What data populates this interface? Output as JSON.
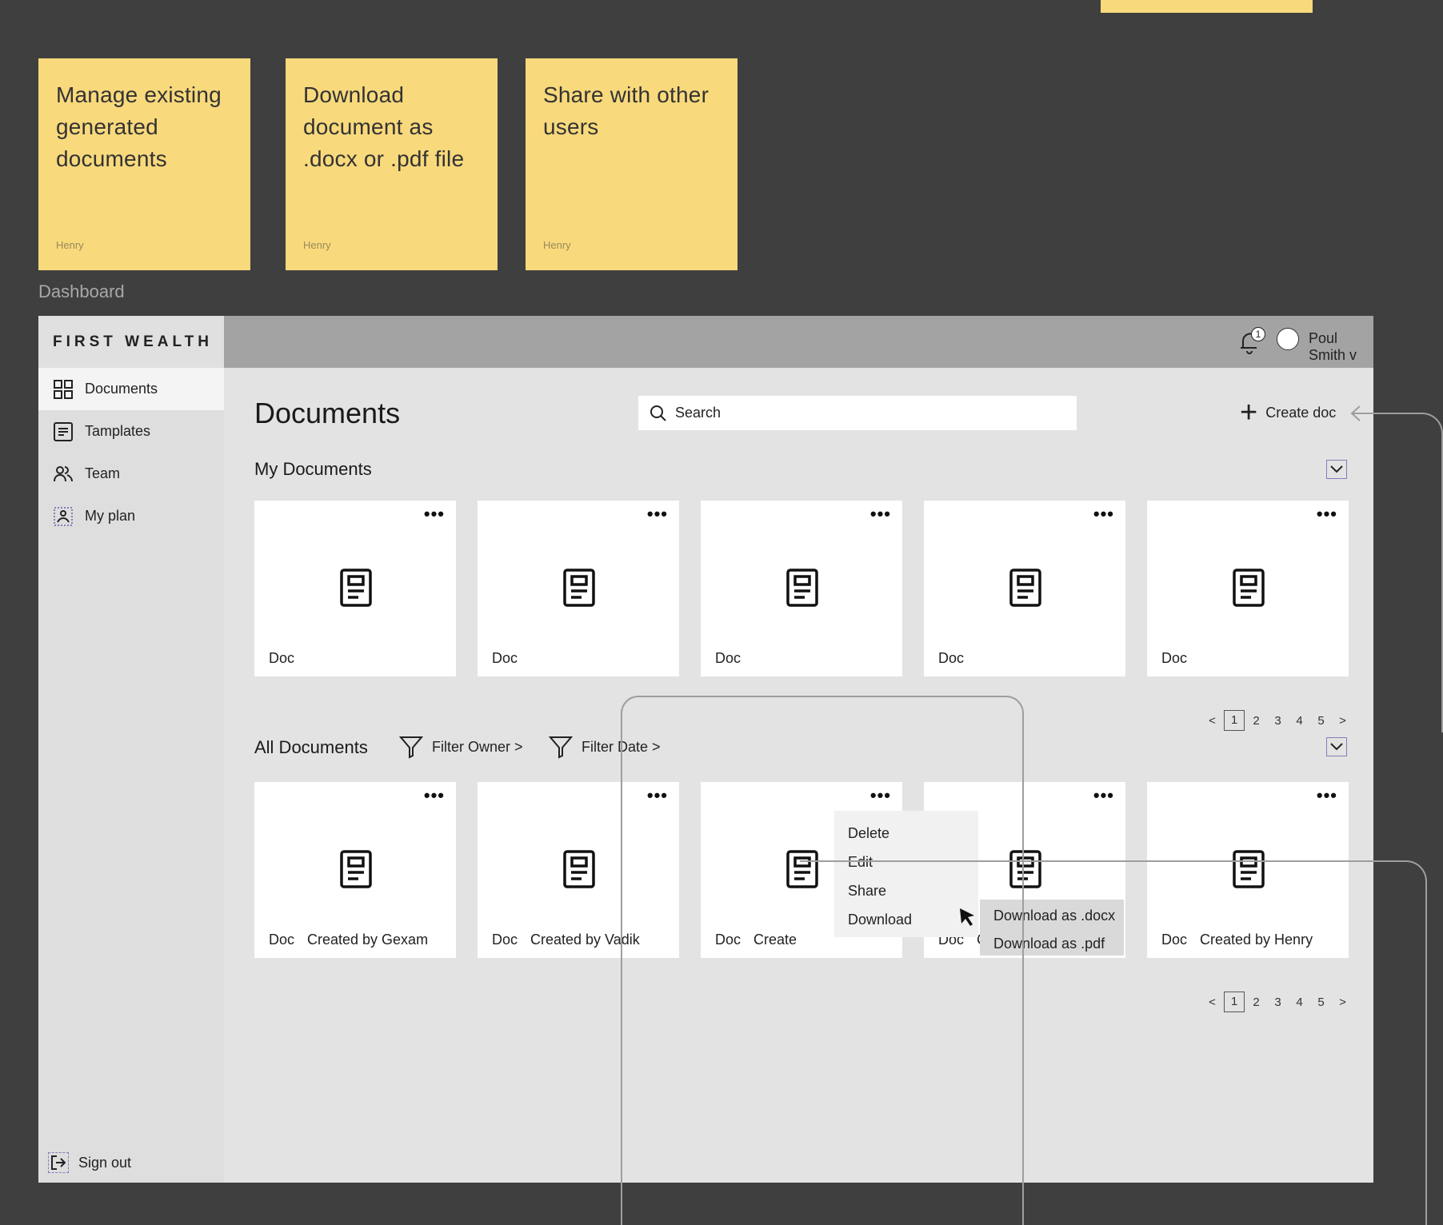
{
  "stickies": [
    {
      "text": "Manage existing generated documents",
      "author": "Henry"
    },
    {
      "text": "Download document as .docx or .pdf file",
      "author": "Henry"
    },
    {
      "text": "Share with other users",
      "author": "Henry"
    }
  ],
  "frame_label": "Dashboard",
  "app": {
    "logo": "FIRST WEALTH",
    "nav": [
      {
        "label": "Documents",
        "icon": "grid-icon"
      },
      {
        "label": "Tamplates",
        "icon": "template-icon"
      },
      {
        "label": "Team",
        "icon": "team-icon"
      },
      {
        "label": "My plan",
        "icon": "plan-icon"
      }
    ],
    "signout": "Sign out",
    "notifications": "1",
    "user_name": "Poul Smith  v",
    "page_title": "Documents",
    "search_placeholder": "Search",
    "create_doc": "Create doc",
    "my_documents": {
      "title": "My Documents",
      "cards": [
        {
          "label": "Doc"
        },
        {
          "label": "Doc"
        },
        {
          "label": "Doc"
        },
        {
          "label": "Doc"
        },
        {
          "label": "Doc"
        }
      ],
      "pages": [
        "1",
        "2",
        "3",
        "4",
        "5"
      ]
    },
    "all_documents": {
      "title": "All Documents",
      "filter_owner": "Filter Owner >",
      "filter_date": "Filter Date >",
      "cards": [
        {
          "label": "Doc",
          "owner": "Created by Gexam"
        },
        {
          "label": "Doc",
          "owner": "Created by Vadik"
        },
        {
          "label": "Doc",
          "owner": "Create"
        },
        {
          "label": "Doc",
          "owner": "Created by Leon"
        },
        {
          "label": "Doc",
          "owner": "Created by Henry"
        }
      ],
      "pages": [
        "1",
        "2",
        "3",
        "4",
        "5"
      ]
    },
    "context_menu": [
      "Delete",
      "Edit",
      "Share",
      "Download"
    ],
    "download_menu": [
      "Download as .docx",
      "Download as .pdf"
    ]
  }
}
